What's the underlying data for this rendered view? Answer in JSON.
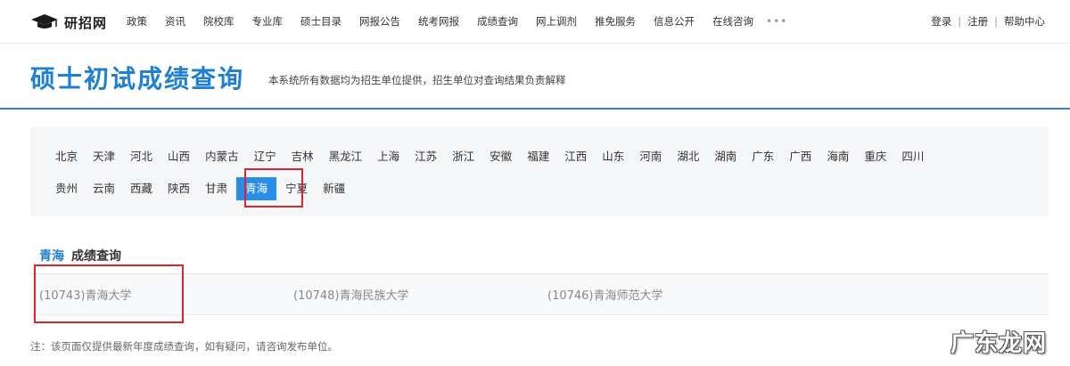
{
  "header": {
    "logo_text": "研招网",
    "nav": [
      "政策",
      "资讯",
      "院校库",
      "专业库",
      "硕士目录",
      "网报公告",
      "统考网报",
      "成绩查询",
      "网上调剂",
      "推免服务",
      "信息公开",
      "在线咨询"
    ],
    "more": "•••",
    "user_links": {
      "login": "登录",
      "register": "注册",
      "help": "帮助中心",
      "sep": "|"
    }
  },
  "title": {
    "main": "硕士初试成绩查询",
    "subtitle": "本系统所有数据均为招生单位提供，招生单位对查询结果负责解释"
  },
  "provinces": {
    "row1": [
      "北京",
      "天津",
      "河北",
      "山西",
      "内蒙古",
      "辽宁",
      "吉林",
      "黑龙江",
      "上海",
      "江苏",
      "浙江",
      "安徽",
      "福建",
      "江西",
      "山东",
      "河南",
      "湖北",
      "湖南",
      "广东",
      "广西",
      "海南",
      "重庆",
      "四川"
    ],
    "row2_before": [
      "贵州",
      "云南",
      "西藏",
      "陕西",
      "甘肃"
    ],
    "active": "青海",
    "row2_after": [
      "宁夏",
      "新疆"
    ]
  },
  "results": {
    "province": "青海",
    "heading_suffix": "成绩查询",
    "universities": [
      "(10743)青海大学",
      "(10748)青海民族大学",
      "(10746)青海师范大学"
    ]
  },
  "note": "注：该页面仅提供最新年度成绩查询，如有疑问，请咨询发布单位。",
  "watermark": "广东龙网",
  "colors": {
    "accent": "#1f7fd1",
    "active_tab": "#2a8ee8",
    "highlight": "#d9262c"
  }
}
